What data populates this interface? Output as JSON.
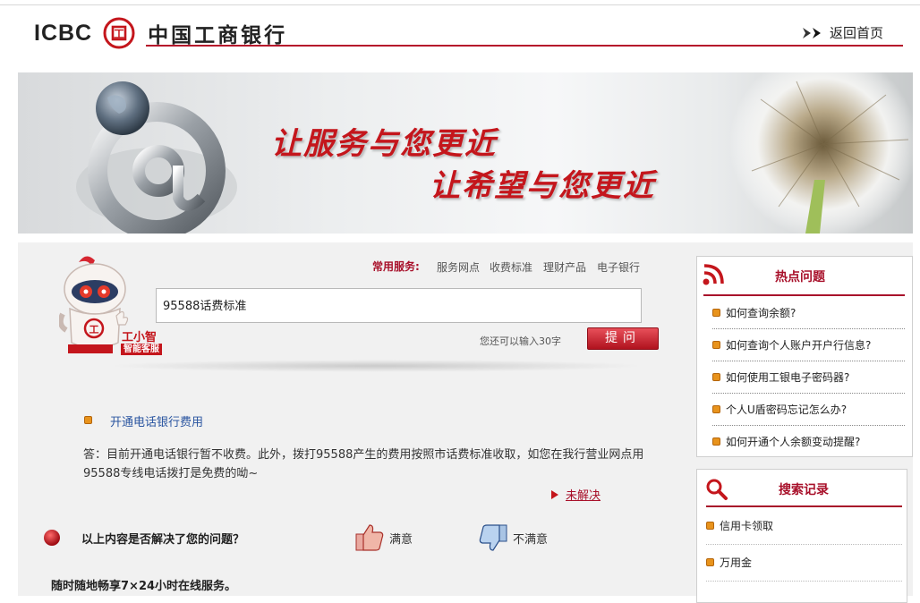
{
  "header": {
    "logo_text": "ICBC",
    "logo_mark_text": "工",
    "bank_name": "中国工商银行",
    "home_link": "返回首页"
  },
  "banner": {
    "slogan_1": "让服务与您更近",
    "slogan_2": "让希望与您更近"
  },
  "assistant": {
    "name": "工小智",
    "tag": "智能客服",
    "badge": "工"
  },
  "services": {
    "label": "常用服务:",
    "links": [
      "服务网点",
      "收费标准",
      "理财产品",
      "电子银行"
    ]
  },
  "search": {
    "query": "95588话费标准",
    "counter": "您还可以输入30字",
    "ask_label": "提问"
  },
  "result": {
    "question": "开通电话银行费用",
    "answer": "答：目前开通电话银行暂不收费。此外，拨打95588产生的费用按照市话费标准收取，如您在我行营业网点用95588专线电话拨打是免费的呦~",
    "unsolved": "未解决"
  },
  "feedback": {
    "prompt": "以上内容是否解决了您的问题？",
    "satisfied": "满意",
    "unsatisfied": "不满意"
  },
  "footer_text": "随时随地畅享7×24小时在线服务。",
  "hot": {
    "title": "热点问题",
    "items": [
      "如何查询余额?",
      "如何查询个人账户开户行信息?",
      "如何使用工银电子密码器?",
      "个人U盾密码忘记怎么办?",
      "如何开通个人余额变动提醒?"
    ]
  },
  "search_history": {
    "title": "搜索记录",
    "items": [
      "信用卡领取",
      "万用金"
    ]
  },
  "colors": {
    "brand_red": "#b5122a",
    "bullet_orange": "#e8931c",
    "link_blue": "#2a55a0"
  }
}
